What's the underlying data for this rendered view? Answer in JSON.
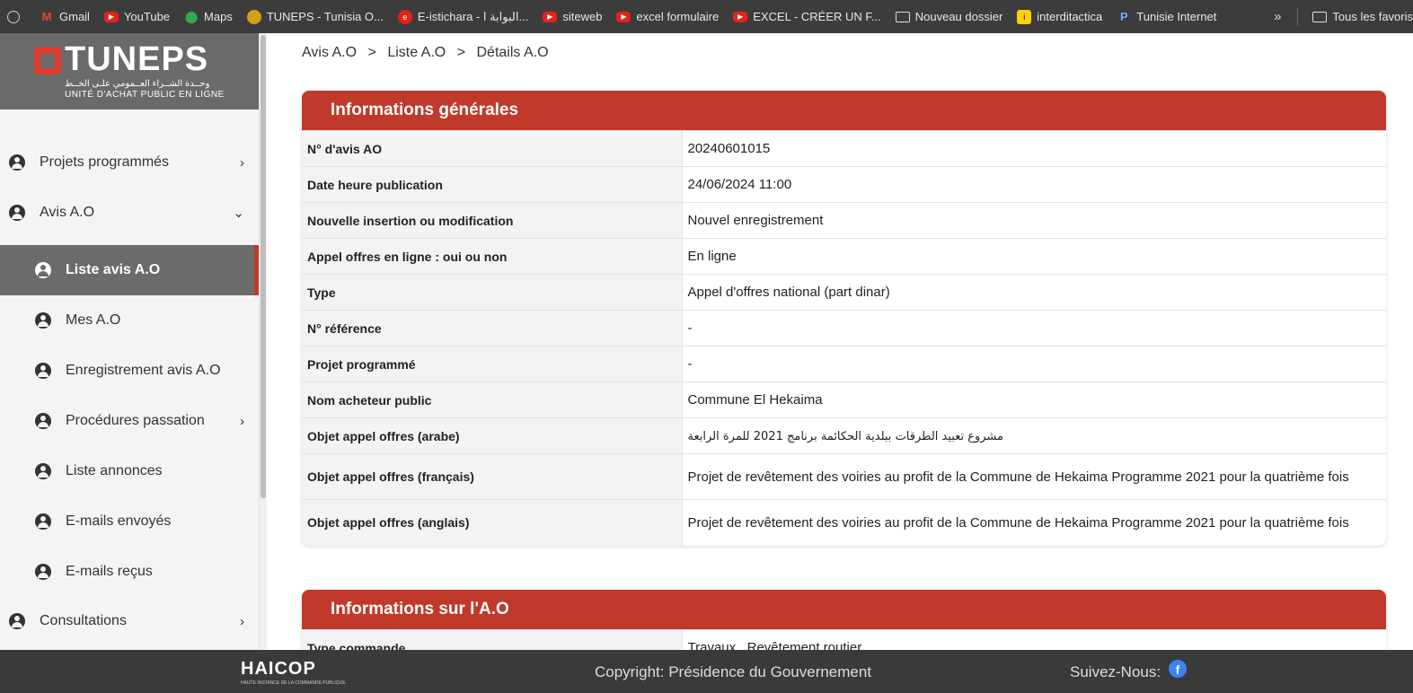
{
  "bookmarks": [
    {
      "label": "Gmail",
      "icon": "gmail-icon"
    },
    {
      "label": "YouTube",
      "icon": "youtube-icon"
    },
    {
      "label": "Maps",
      "icon": "maps-icon"
    },
    {
      "label": "TUNEPS - Tunisia O...",
      "icon": "tuneps-icon"
    },
    {
      "label": "E-istichara - البوابة ا...",
      "icon": "estichara-icon"
    },
    {
      "label": "siteweb",
      "icon": "youtube-icon"
    },
    {
      "label": "excel formulaire",
      "icon": "youtube-icon"
    },
    {
      "label": "EXCEL - CRÉER UN F...",
      "icon": "youtube-icon"
    },
    {
      "label": "Nouveau dossier",
      "icon": "folder-icon"
    },
    {
      "label": "interditactica",
      "icon": "interditactica-icon"
    },
    {
      "label": "Tunisie Internet",
      "icon": "tunisie-internet-icon"
    }
  ],
  "bookmarks_more": "»",
  "bookmarks_all": "Tous les favoris",
  "logo": {
    "title": "TUNEPS",
    "arabic": "وحــدة الشــراء العــمومي علـى الخــط",
    "subtitle": "UNITÉ D'ACHAT PUBLIC EN LIGNE"
  },
  "sidebar": {
    "items": [
      {
        "label": "Projets programmés",
        "chevron": "›"
      },
      {
        "label": "Avis A.O",
        "chevron": "⌄"
      },
      {
        "label": "Liste avis A.O"
      },
      {
        "label": "Mes A.O"
      },
      {
        "label": "Enregistrement avis A.O"
      },
      {
        "label": "Procédures passation",
        "chevron": "›"
      },
      {
        "label": "Liste annonces"
      },
      {
        "label": "E-mails envoyés"
      },
      {
        "label": "E-mails reçus"
      },
      {
        "label": "Consultations",
        "chevron": "›"
      }
    ]
  },
  "breadcrumb": {
    "items": [
      "Avis A.O",
      "Liste A.O",
      "Détails A.O"
    ],
    "separator": ">"
  },
  "general_info": {
    "title": "Informations générales",
    "rows": [
      {
        "label": "N° d'avis AO",
        "value": "20240601015"
      },
      {
        "label": "Date heure publication",
        "value": "24/06/2024 11:00"
      },
      {
        "label": "Nouvelle insertion ou modification",
        "value": "Nouvel enregistrement"
      },
      {
        "label": "Appel offres en ligne : oui ou non",
        "value": "En ligne"
      },
      {
        "label": "Type",
        "value": "Appel d'offres national (part dinar)"
      },
      {
        "label": "N° référence",
        "value": "-"
      },
      {
        "label": "Projet programmé",
        "value": "-"
      },
      {
        "label": "Nom acheteur public",
        "value": "Commune El Hekaima"
      },
      {
        "label": "Objet appel offres (arabe)",
        "value": "مشروع تعبيد الطرقات ببلدية الحكائمة برنامج 2021 للمرة الرابعة"
      },
      {
        "label": "Objet appel offres (français)",
        "value": "Projet de revêtement des voiries au profit de la Commune de Hekaima Programme 2021 pour la quatrième fois"
      },
      {
        "label": "Objet appel offres (anglais)",
        "value": "Projet de revêtement des voiries au profit de la Commune de Hekaima Programme 2021 pour la quatrième fois"
      }
    ]
  },
  "ao_info": {
    "title": "Informations sur l'A.O",
    "rows": [
      {
        "label": "Type commande",
        "value": "Travaux , Revêtement routier"
      }
    ]
  },
  "footer": {
    "brand": "HAICOP",
    "brand_sub": "HAUTE INSTANCE DE LA COMMANDE PUBLIQUE",
    "copyright": "Copyright: Présidence du Gouvernement",
    "follow": "Suivez-Nous:",
    "facebook": "f"
  },
  "colors": {
    "accent": "#c0392b",
    "sidebar_active": "#6b6b6b",
    "footer_bg": "#3a3a3a"
  }
}
